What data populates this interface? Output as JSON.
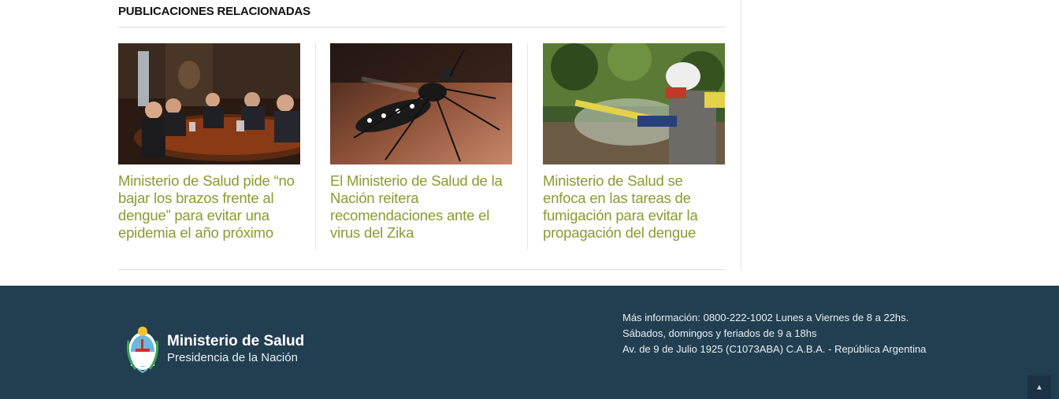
{
  "section": {
    "title": "PUBLICACIONES RELACIONADAS"
  },
  "cards": [
    {
      "headline": "Ministerio de Salud pide “no bajar los brazos frente al dengue” para evitar una epidemia el año próximo",
      "image": "meeting-photo"
    },
    {
      "headline": "El Ministerio de Salud de la Nación reitera recomendaciones ante el virus del Zika",
      "image": "mosquito-photo"
    },
    {
      "headline": "Ministerio de Salud se enfoca en las tareas de fumigación para evitar la propagación del dengue",
      "image": "fumigation-photo"
    }
  ],
  "footer": {
    "brand_name": "Ministerio de Salud",
    "brand_sub": "Presidencia de la Nación",
    "info_line1": "Más información: 0800-222-1002 Lunes a Viernes de 8 a 22hs.",
    "info_line2": "Sábados, domingos y feriados de 9 a 18hs",
    "info_line3": "Av. de 9 de Julio 1925 (C1073ABA) C.A.B.A. - República Argentina",
    "back_to_top_icon": "chevron-up-icon"
  },
  "colors": {
    "headline": "#8c9a2f",
    "footer_bg": "#223f52"
  }
}
